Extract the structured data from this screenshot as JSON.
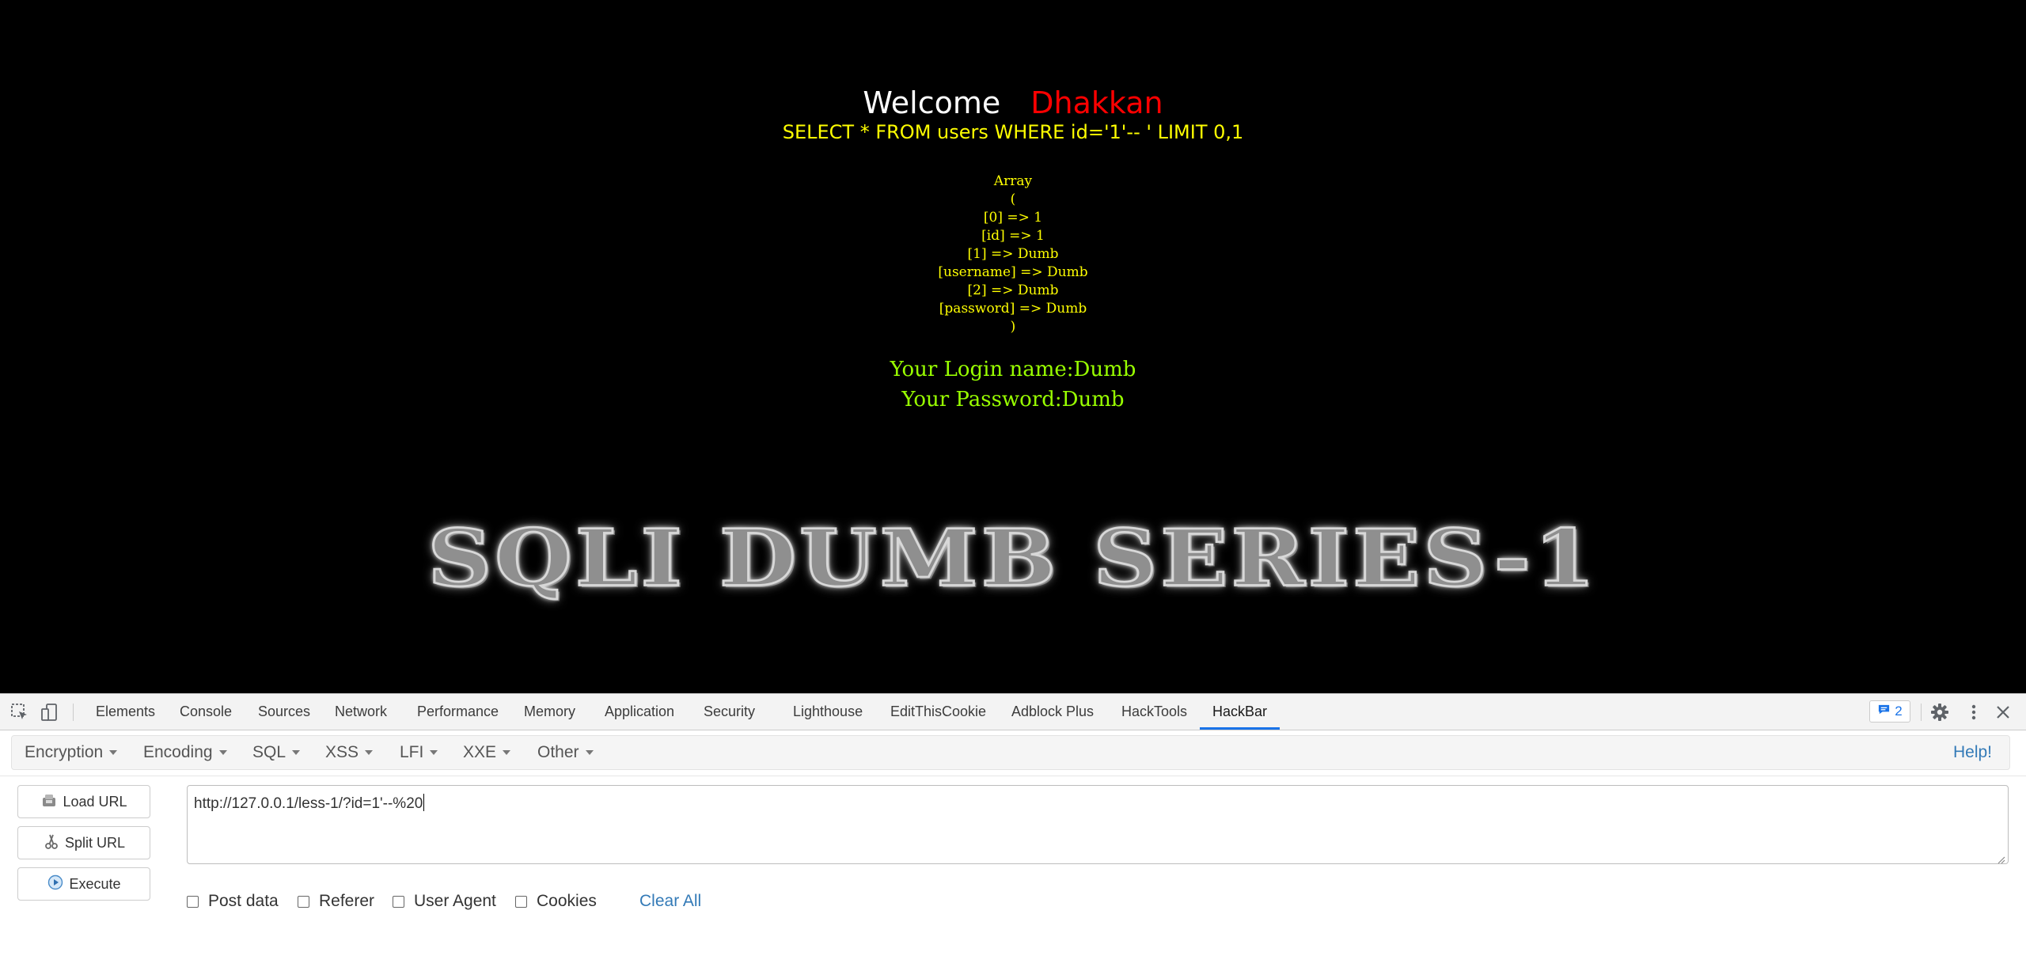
{
  "page": {
    "welcome_label": "Welcome",
    "welcome_name": "Dhakkan",
    "query": "SELECT * FROM users WHERE id='1'-- ' LIMIT 0,1",
    "array_lines": [
      "Array",
      "(",
      "[0] => 1",
      "[id] => 1",
      "[1] => Dumb",
      "[username] => Dumb",
      "[2] => Dumb",
      "[password] => Dumb",
      ")"
    ],
    "login_name": "Your Login name:Dumb",
    "password": "Your Password:Dumb",
    "banner": "SQLI DUMB SERIES-1"
  },
  "devtools": {
    "tabs": [
      "Elements",
      "Console",
      "Sources",
      "Network",
      "Performance",
      "Memory",
      "Application",
      "Security",
      "Lighthouse",
      "EditThisCookie",
      "Adblock Plus",
      "HackTools",
      "HackBar"
    ],
    "active_tab": "HackBar",
    "issues_count": "2",
    "icons": [
      "inspect-icon",
      "device-toggle-icon",
      "issues-icon",
      "gear-icon",
      "kebab-menu-icon",
      "close-icon"
    ]
  },
  "hackbar": {
    "menus": [
      "Encryption",
      "Encoding",
      "SQL",
      "XSS",
      "LFI",
      "XXE",
      "Other"
    ],
    "help": "Help!",
    "buttons": {
      "load": "Load URL",
      "split": "Split URL",
      "execute": "Execute"
    },
    "url": "http://127.0.0.1/less-1/?id=1'--%20",
    "options": {
      "post": "Post data",
      "referer": "Referer",
      "user_agent": "User Agent",
      "cookies": "Cookies"
    },
    "clear_all": "Clear All"
  },
  "colors": {
    "page_bg": "#000000",
    "welcome_name": "#ff0000",
    "query": "#ffff00",
    "login": "#99ff00",
    "accent": "#1a73e8",
    "link": "#337ab7"
  }
}
